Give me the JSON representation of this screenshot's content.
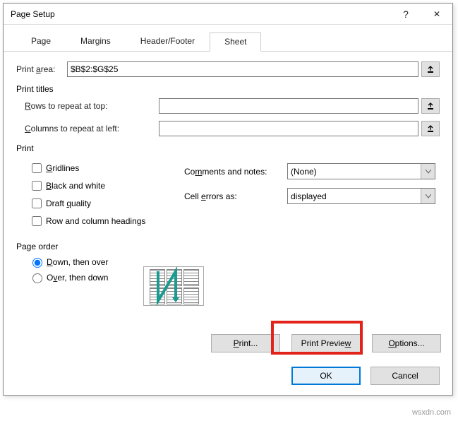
{
  "titlebar": {
    "title": "Page Setup",
    "help": "?",
    "close": "✕"
  },
  "tabs": {
    "page": "Page",
    "margins": "Margins",
    "header_footer": "Header/Footer",
    "sheet": "Sheet"
  },
  "print_area": {
    "label": "Print area:",
    "value": "$B$2:$G$25"
  },
  "print_titles": {
    "group_label": "Print titles",
    "rows_label": "Rows to repeat at top:",
    "rows_value": "",
    "cols_label": "Columns to repeat at left:",
    "cols_value": ""
  },
  "print_group": {
    "label": "Print",
    "gridlines": "Gridlines",
    "black_white": "Black and white",
    "draft": "Draft quality",
    "rowcol_headings": "Row and column headings",
    "comments_label": "Comments and notes:",
    "comments_value": "(None)",
    "cellerrors_label": "Cell errors as:",
    "cellerrors_value": "displayed"
  },
  "page_order": {
    "label": "Page order",
    "down_over": "Down, then over",
    "over_down": "Over, then down"
  },
  "buttons": {
    "print": "Print...",
    "preview": "Print Preview",
    "options": "Options...",
    "ok": "OK",
    "cancel": "Cancel"
  },
  "watermark": "wsxdn.com"
}
